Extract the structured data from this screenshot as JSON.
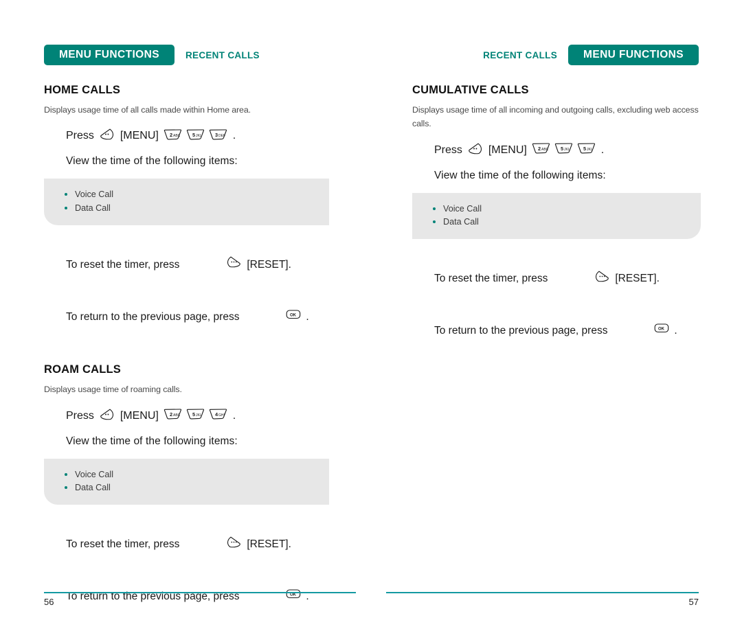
{
  "document": {
    "type": "phone-user-manual-spread"
  },
  "colors": {
    "teal": "#008377",
    "rule_teal": "#149aa2",
    "panel_grey": "#e7e7e7",
    "bullet_teal": "#008377"
  },
  "left_page": {
    "header": {
      "active_tab": "MENU FUNCTIONS",
      "inactive_tab": "RECENT CALLS"
    },
    "sections": [
      {
        "title": "HOME CALLS",
        "description": "Displays usage time of all calls made within Home area.",
        "press_label": "Press",
        "menu_label": "[MENU]",
        "period": ".",
        "keys": [
          {
            "digit": "2",
            "letters": "ABC"
          },
          {
            "digit": "5",
            "letters": "JKL"
          },
          {
            "digit": "3",
            "letters": "DEF"
          }
        ],
        "view_line": "View the time of the following items:",
        "items": [
          "Voice Call",
          "Data Call"
        ],
        "reset_prefix": "To reset the timer, press",
        "reset_label": "[RESET].",
        "return_prefix": "To return to the previous page, press",
        "return_suffix": "."
      },
      {
        "title": "ROAM CALLS",
        "description": "Displays usage time of roaming calls.",
        "press_label": "Press",
        "menu_label": "[MENU]",
        "period": ".",
        "keys": [
          {
            "digit": "2",
            "letters": "ABC"
          },
          {
            "digit": "5",
            "letters": "JKL"
          },
          {
            "digit": "4",
            "letters": "GHI"
          }
        ],
        "view_line": "View the time of the following items:",
        "items": [
          "Voice Call",
          "Data Call"
        ],
        "reset_prefix": "To reset the timer, press",
        "reset_label": "[RESET].",
        "return_prefix": "To return to the previous page, press",
        "return_suffix": "."
      }
    ],
    "footer": {
      "page_number": "56"
    }
  },
  "right_page": {
    "header": {
      "active_tab": "MENU FUNCTIONS",
      "inactive_tab": "RECENT CALLS"
    },
    "sections": [
      {
        "title": "CUMULATIVE CALLS",
        "description": "Displays usage time of all incoming and outgoing calls, excluding web access calls.",
        "press_label": "Press",
        "menu_label": "[MENU]",
        "period": ".",
        "keys": [
          {
            "digit": "2",
            "letters": "ABC"
          },
          {
            "digit": "5",
            "letters": "JKL"
          },
          {
            "digit": "5",
            "letters": "JKL"
          }
        ],
        "view_line": "View the time of the following items:",
        "items": [
          "Voice Call",
          "Data Call"
        ],
        "reset_prefix": "To reset the timer, press",
        "reset_label": "[RESET].",
        "return_prefix": "To return to the previous page, press",
        "return_suffix": "."
      }
    ],
    "footer": {
      "page_number": "57"
    }
  },
  "icons": {
    "left_softkey": "left-softkey-icon",
    "right_softkey": "right-softkey-icon",
    "ok_key": "ok-key-icon",
    "ok_label": "OK"
  }
}
